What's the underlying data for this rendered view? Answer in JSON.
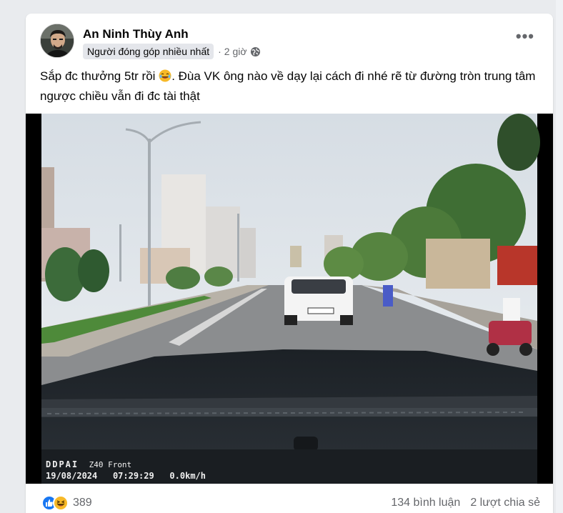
{
  "post": {
    "author": "An Ninh Thùy Anh",
    "badge": "Người đóng góp nhiều nhất",
    "separator": "·",
    "time": "2 giờ",
    "text": "Sắp đc thưởng 5tr rồi",
    "text_rest": ". Đùa VK ông nào về dạy lại cách đi nhé rẽ từ đường tròn trung tâm ngược chiều vẫn đi đc tài thật",
    "more_label": "•••"
  },
  "video": {
    "brand": "DDPAI",
    "model": "Z40 Front",
    "date": "19/08/2024",
    "time": "07:29:29",
    "speed": "0.0km/h",
    "plate": "29H-999.48"
  },
  "footer": {
    "reaction_count": "389",
    "comments": "134 bình luận",
    "shares": "2 lượt chia sẻ"
  },
  "colors": {
    "like_blue": "#1877f2",
    "haha_yellow": "#f7b928",
    "text_secondary": "#65676b"
  }
}
